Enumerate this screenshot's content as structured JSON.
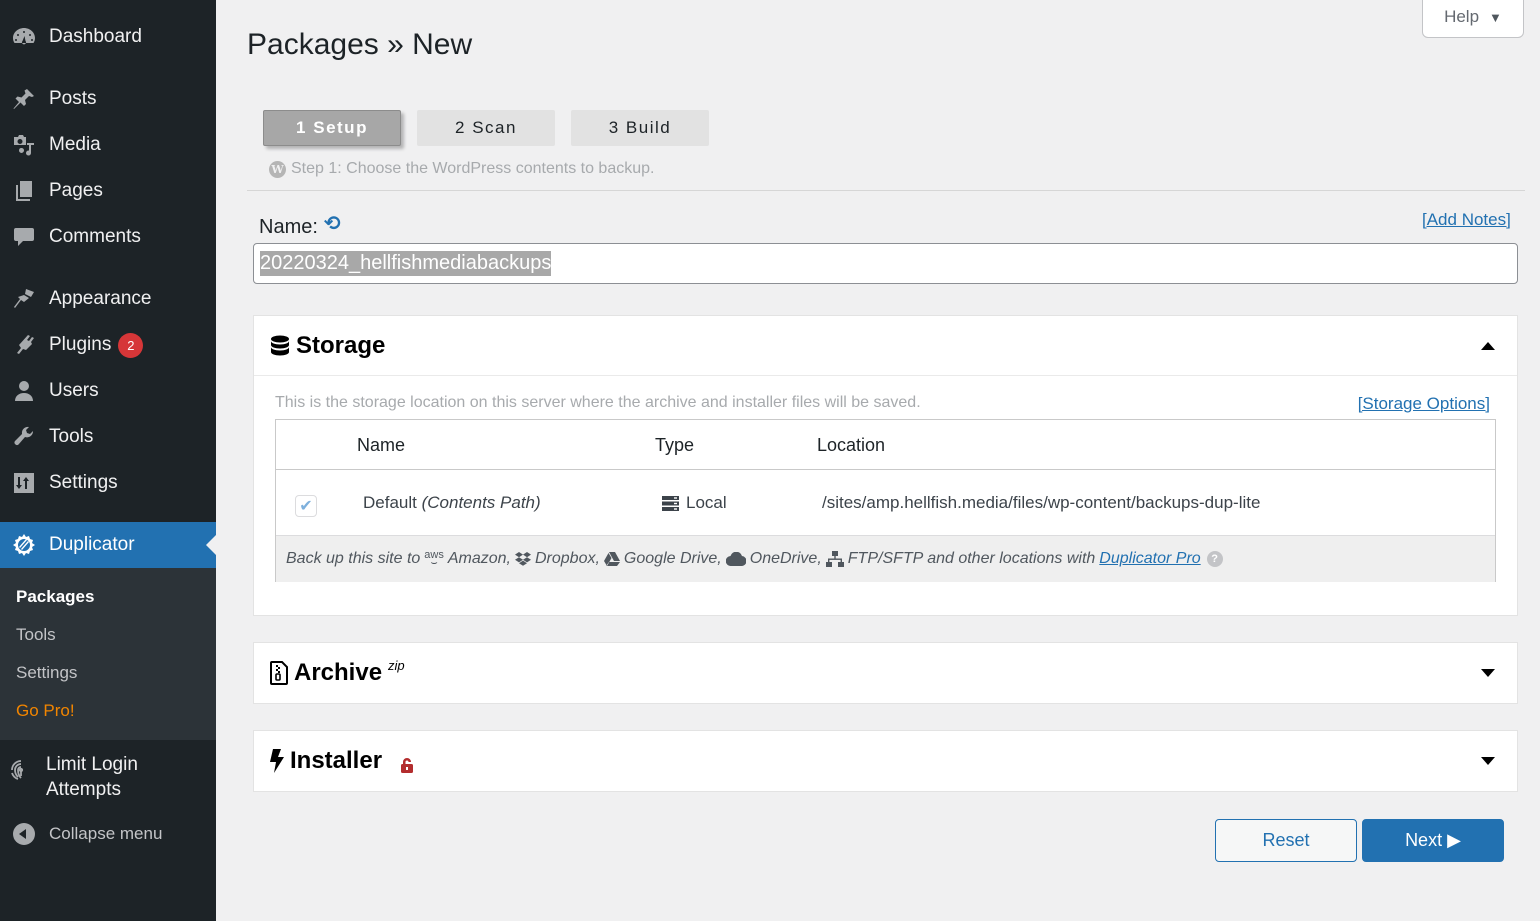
{
  "sidebar": {
    "items": [
      {
        "label": "Dashboard",
        "icon": "dashboard-icon"
      },
      {
        "label": "Posts",
        "icon": "pushpin-icon"
      },
      {
        "label": "Media",
        "icon": "media-icon"
      },
      {
        "label": "Pages",
        "icon": "pages-icon"
      },
      {
        "label": "Comments",
        "icon": "comment-icon"
      },
      {
        "label": "Appearance",
        "icon": "paintbrush-icon"
      },
      {
        "label": "Plugins",
        "icon": "plugin-icon",
        "badge": "2"
      },
      {
        "label": "Users",
        "icon": "user-icon"
      },
      {
        "label": "Tools",
        "icon": "wrench-icon"
      },
      {
        "label": "Settings",
        "icon": "settings-icon"
      },
      {
        "label": "Duplicator",
        "icon": "duplicator-icon",
        "active": true
      },
      {
        "label": "Limit Login Attempts",
        "icon": "fingerprint-icon"
      },
      {
        "label": "Collapse menu",
        "icon": "collapse-icon"
      }
    ],
    "submenu": [
      {
        "label": "Packages",
        "current": true
      },
      {
        "label": "Tools"
      },
      {
        "label": "Settings"
      },
      {
        "label": "Go Pro!"
      }
    ]
  },
  "header": {
    "title": "Packages » New",
    "help_label": "Help"
  },
  "steps": {
    "items": [
      {
        "label": "1 Setup",
        "active": true
      },
      {
        "label": "2 Scan"
      },
      {
        "label": "3 Build"
      }
    ],
    "description": "Step 1: Choose the WordPress contents to backup."
  },
  "name_field": {
    "label": "Name:",
    "value": "20220324_hellfishmediabackups",
    "add_notes": "[Add Notes]"
  },
  "storage": {
    "title": "Storage",
    "description": "This is the storage location on this server where the archive and installer files will be saved.",
    "options_link": "[Storage Options]",
    "columns": [
      "Name",
      "Type",
      "Location"
    ],
    "rows": [
      {
        "checked": true,
        "name": "Default",
        "name_note": "(Contents Path)",
        "type": "Local",
        "location": "/sites/amp.hellfish.media/files/wp-content/backups-dup-lite"
      }
    ],
    "footer": {
      "prefix": "Back up this site to",
      "amazon": "Amazon,",
      "dropbox": "Dropbox,",
      "gdrive": "Google Drive,",
      "onedrive": "OneDrive,",
      "ftp": "FTP/SFTP and other locations with",
      "pro_link": "Duplicator Pro",
      "aws_mark": "aws"
    }
  },
  "archive": {
    "title": "Archive",
    "format": "zip"
  },
  "installer": {
    "title": "Installer"
  },
  "actions": {
    "reset": "Reset",
    "next": "Next ▶"
  },
  "colors": {
    "accent": "#2271b1",
    "sidebar_bg": "#1d2327",
    "submenu_bg": "#2c3338",
    "badge": "#d63638",
    "go_pro": "#f18500",
    "lock": "#b32d2e"
  }
}
